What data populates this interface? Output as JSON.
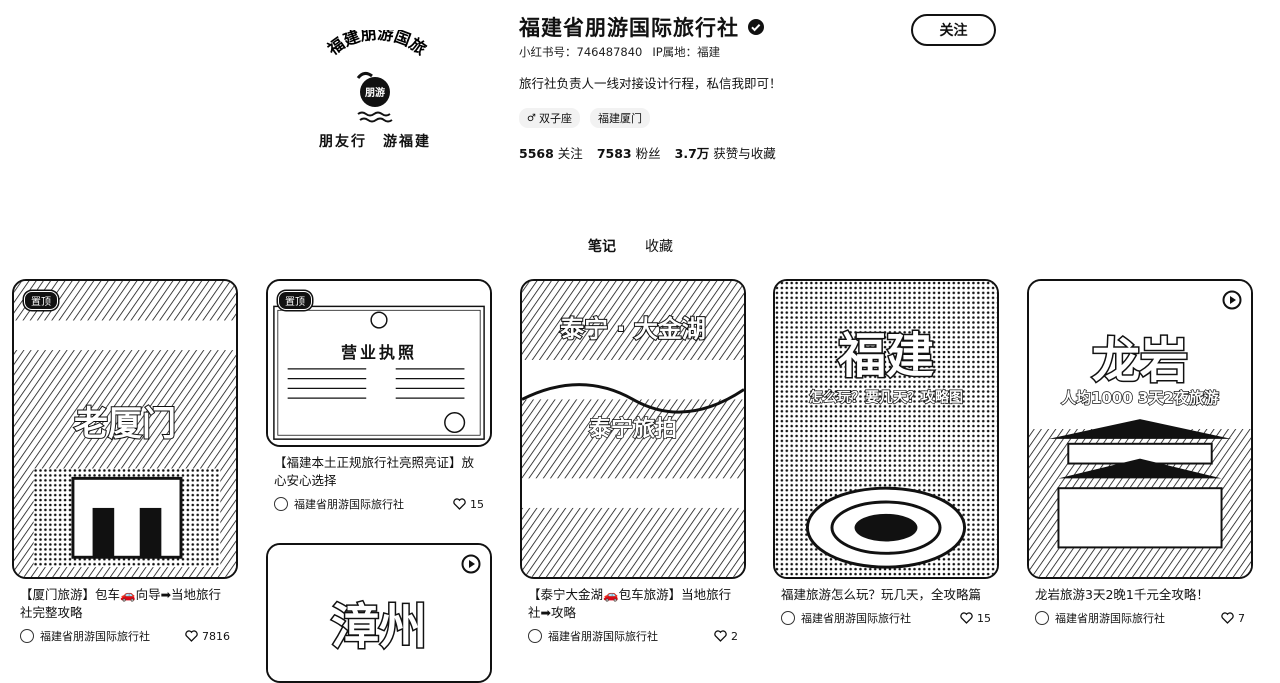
{
  "profile": {
    "avatar_arc_text": "福建朋游国旅",
    "avatar_slogan": "朋友行　游福建",
    "avatar_badge": "朋游",
    "name": "福建省朋游国际旅行社",
    "follow_label": "关注",
    "redbook_id": "小红书号：746487840",
    "ip_location": "IP属地：福建",
    "bio": "旅行社负责人一线对接设计行程，私信我即可！",
    "tags": [
      {
        "icon": "male-icon",
        "text": "双子座"
      },
      {
        "icon": "",
        "text": "福建厦门"
      }
    ],
    "stats": [
      {
        "num": "5568",
        "label": "关注"
      },
      {
        "num": "7583",
        "label": "粉丝"
      },
      {
        "num": "3.7万",
        "label": "获赞与收藏"
      }
    ]
  },
  "tabs": [
    {
      "label": "笔记",
      "active": true
    },
    {
      "label": "收藏",
      "active": false
    }
  ],
  "notes": [
    {
      "pinned": true,
      "pin_label": "置顶",
      "video": false,
      "overlay_title": "老厦门",
      "overlay_sub": "",
      "caption": "【厦门旅游】包车🚗向导➡当地旅行社完整攻略",
      "author": "福建省朋游国际旅行社",
      "likes": "7816"
    },
    {
      "pinned": true,
      "pin_label": "置顶",
      "video": false,
      "overlay_title": "营业执照",
      "overlay_sub": "",
      "caption": "【福建本土正规旅行社亮照亮证】放心安心选择",
      "author": "福建省朋游国际旅行社",
      "likes": "15"
    },
    {
      "pinned": false,
      "video": true,
      "overlay_title": "漳州",
      "overlay_sub": "",
      "caption": "",
      "author": "",
      "likes": ""
    },
    {
      "pinned": false,
      "video": false,
      "overlay_title": "泰宁 · 大金湖",
      "overlay_sub": "泰宁旅拍",
      "caption": "【泰宁大金湖🚗包车旅游】当地旅行社➡攻略",
      "author": "福建省朋游国际旅行社",
      "likes": "2"
    },
    {
      "pinned": false,
      "video": false,
      "overlay_title": "福建",
      "overlay_sub": "怎么玩？要几天？攻略图",
      "caption": "福建旅游怎么玩？玩几天，全攻略篇",
      "author": "福建省朋游国际旅行社",
      "likes": "15"
    },
    {
      "pinned": false,
      "video": true,
      "overlay_title": "龙岩",
      "overlay_sub": "人均1000 3天2夜旅游",
      "caption": "龙岩旅游3天2晚1千元全攻略！",
      "author": "福建省朋游国际旅行社",
      "likes": "7"
    }
  ]
}
